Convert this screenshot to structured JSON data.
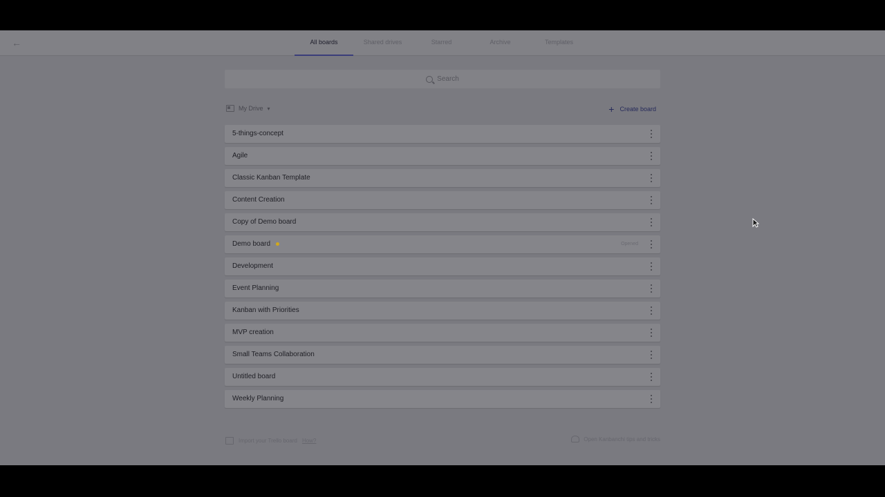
{
  "topbar": {
    "back_icon": "arrow-left-icon",
    "tabs": [
      {
        "label": "All boards",
        "active": true
      },
      {
        "label": "Shared drives",
        "active": false
      },
      {
        "label": "Starred",
        "active": false
      },
      {
        "label": "Archive",
        "active": false
      },
      {
        "label": "Templates",
        "active": false
      }
    ]
  },
  "search": {
    "placeholder": "Search"
  },
  "section": {
    "drive_label": "My Drive",
    "create_label": "Create board"
  },
  "boards": [
    {
      "title": "5-things-concept"
    },
    {
      "title": "Agile"
    },
    {
      "title": "Classic Kanban Template"
    },
    {
      "title": "Content Creation"
    },
    {
      "title": "Copy of Demo board"
    },
    {
      "title": "Demo board",
      "starred": true,
      "status": "Opened"
    },
    {
      "title": "Development"
    },
    {
      "title": "Event Planning"
    },
    {
      "title": "Kanban with Priorities"
    },
    {
      "title": "MVP creation"
    },
    {
      "title": "Small Teams Collaboration"
    },
    {
      "title": "Untitled board"
    },
    {
      "title": "Weekly Planning"
    }
  ],
  "footer": {
    "import_text": "Import your Trello board",
    "how_link": "How?",
    "tips_text": "Open Kanbanchi tips and tricks"
  },
  "colors": {
    "accent": "#3a3d7a",
    "star": "#d1a81c"
  }
}
